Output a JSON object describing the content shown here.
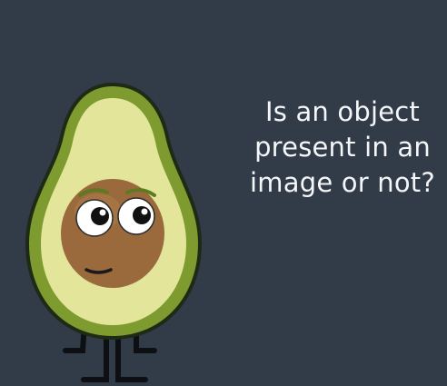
{
  "caption": {
    "lines": [
      "Is an object",
      "present in an",
      "image or not?"
    ]
  },
  "character": {
    "name": "avocado",
    "colors": {
      "background": "#323c49",
      "skin_outline": "#1f2a16",
      "skin": "#7d9b2e",
      "flesh": "#e3e59b",
      "pit": "#9a6a3c",
      "eye_white": "#ffffff",
      "pupil": "#111111"
    }
  }
}
